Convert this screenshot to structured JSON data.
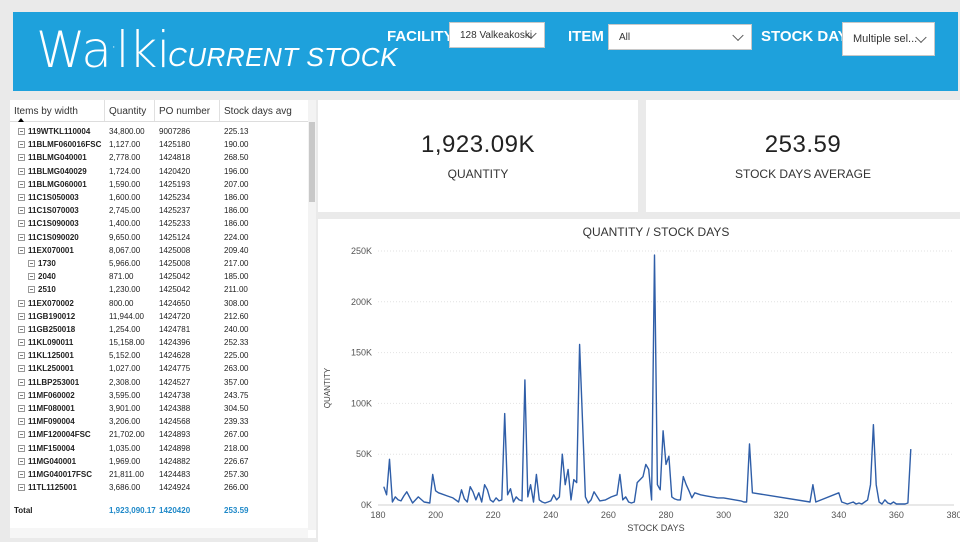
{
  "header": {
    "logo": "walki",
    "title": "CURRENT STOCK",
    "filters": [
      {
        "label": "FACILITY",
        "value": "128 Valkeakoski"
      },
      {
        "label": "ITEM",
        "value": "All"
      },
      {
        "label": "STOCK DAYS",
        "value": "Multiple sel..."
      }
    ]
  },
  "table": {
    "columns": [
      "Items by width",
      "Quantity",
      "PO number",
      "Stock days avg"
    ],
    "rows": [
      {
        "item": "119WTKL110004",
        "qty": "34,800.00",
        "po": "9007286",
        "days": "225.13",
        "level": 0
      },
      {
        "item": "11BLMF060016FSC",
        "qty": "1,127.00",
        "po": "1425180",
        "days": "190.00",
        "level": 0
      },
      {
        "item": "11BLMG040001",
        "qty": "2,778.00",
        "po": "1424818",
        "days": "268.50",
        "level": 0
      },
      {
        "item": "11BLMG040029",
        "qty": "1,724.00",
        "po": "1420420",
        "days": "196.00",
        "level": 0
      },
      {
        "item": "11BLMG060001",
        "qty": "1,590.00",
        "po": "1425193",
        "days": "207.00",
        "level": 0
      },
      {
        "item": "11C1S050003",
        "qty": "1,600.00",
        "po": "1425234",
        "days": "186.00",
        "level": 0
      },
      {
        "item": "11C1S070003",
        "qty": "2,745.00",
        "po": "1425237",
        "days": "186.00",
        "level": 0
      },
      {
        "item": "11C1S090003",
        "qty": "1,400.00",
        "po": "1425233",
        "days": "186.00",
        "level": 0
      },
      {
        "item": "11C1S090020",
        "qty": "9,650.00",
        "po": "1425124",
        "days": "224.00",
        "level": 0
      },
      {
        "item": "11EX070001",
        "qty": "8,067.00",
        "po": "1425008",
        "days": "209.40",
        "level": 0
      },
      {
        "item": "1730",
        "qty": "5,966.00",
        "po": "1425008",
        "days": "217.00",
        "level": 1
      },
      {
        "item": "2040",
        "qty": "871.00",
        "po": "1425042",
        "days": "185.00",
        "level": 1
      },
      {
        "item": "2510",
        "qty": "1,230.00",
        "po": "1425042",
        "days": "211.00",
        "level": 1
      },
      {
        "item": "11EX070002",
        "qty": "800.00",
        "po": "1424650",
        "days": "308.00",
        "level": 0
      },
      {
        "item": "11GB190012",
        "qty": "11,944.00",
        "po": "1424720",
        "days": "212.60",
        "level": 0
      },
      {
        "item": "11GB250018",
        "qty": "1,254.00",
        "po": "1424781",
        "days": "240.00",
        "level": 0
      },
      {
        "item": "11KL090011",
        "qty": "15,158.00",
        "po": "1424396",
        "days": "252.33",
        "level": 0
      },
      {
        "item": "11KL125001",
        "qty": "5,152.00",
        "po": "1424628",
        "days": "225.00",
        "level": 0
      },
      {
        "item": "11KL250001",
        "qty": "1,027.00",
        "po": "1424775",
        "days": "263.00",
        "level": 0
      },
      {
        "item": "11LBP253001",
        "qty": "2,308.00",
        "po": "1424527",
        "days": "357.00",
        "level": 0
      },
      {
        "item": "11MF060002",
        "qty": "3,595.00",
        "po": "1424738",
        "days": "243.75",
        "level": 0
      },
      {
        "item": "11MF080001",
        "qty": "3,901.00",
        "po": "1424388",
        "days": "304.50",
        "level": 0
      },
      {
        "item": "11MF090004",
        "qty": "3,206.00",
        "po": "1424568",
        "days": "239.33",
        "level": 0
      },
      {
        "item": "11MF120004FSC",
        "qty": "21,702.00",
        "po": "1424893",
        "days": "267.00",
        "level": 0
      },
      {
        "item": "11MF150004",
        "qty": "1,035.00",
        "po": "1424898",
        "days": "218.00",
        "level": 0
      },
      {
        "item": "11MG040001",
        "qty": "1,969.00",
        "po": "1424882",
        "days": "226.67",
        "level": 0
      },
      {
        "item": "11MG040017FSC",
        "qty": "21,811.00",
        "po": "1424483",
        "days": "257.30",
        "level": 0
      },
      {
        "item": "11TL1125001",
        "qty": "3,686.00",
        "po": "1424924",
        "days": "266.00",
        "level": 0
      }
    ],
    "total": {
      "label": "Total",
      "qty": "1,923,090.17",
      "po": "1420420",
      "days": "253.59"
    }
  },
  "kpis": [
    {
      "value": "1,923.09K",
      "label": "QUANTITY"
    },
    {
      "value": "253.59",
      "label": "STOCK DAYS AVERAGE"
    }
  ],
  "chart_data": {
    "type": "line",
    "title": "QUANTITY / STOCK DAYS",
    "xlabel": "STOCK DAYS",
    "ylabel": "QUANTITY",
    "xlim": [
      180,
      380
    ],
    "ylim": [
      0,
      250000
    ],
    "xticks": [
      180,
      200,
      220,
      240,
      260,
      280,
      300,
      320,
      340,
      360,
      380
    ],
    "yticks": [
      0,
      50000,
      100000,
      150000,
      200000,
      250000
    ],
    "ytick_labels": [
      "0K",
      "50K",
      "100K",
      "150K",
      "200K",
      "250K"
    ],
    "color": "#2f5ea8",
    "series": [
      {
        "x": [
          182,
          183,
          184,
          185,
          186,
          187,
          188,
          189,
          190,
          192,
          194,
          196,
          198,
          199,
          200,
          201,
          202,
          204,
          206,
          208,
          209,
          210,
          211,
          212,
          213,
          214,
          215,
          216,
          217,
          218,
          219,
          220,
          221,
          222,
          223,
          224,
          225,
          226,
          227,
          228,
          229,
          230,
          231,
          232,
          233,
          234,
          235,
          236,
          237,
          238,
          239,
          240,
          241,
          242,
          243,
          244,
          245,
          246,
          247,
          248,
          249,
          250,
          252,
          253,
          254,
          255,
          257,
          259,
          261,
          263,
          264,
          265,
          266,
          267,
          268,
          269,
          270,
          272,
          273,
          274,
          275,
          276,
          277,
          278,
          279,
          280,
          281,
          282,
          283,
          284,
          285,
          286,
          287,
          288,
          289,
          290,
          292,
          294,
          296,
          298,
          300,
          302,
          304,
          306,
          307,
          308,
          309,
          310,
          330,
          331,
          332,
          340,
          341,
          342,
          343,
          344,
          345,
          346,
          347,
          348,
          349,
          350,
          351,
          352,
          353,
          354,
          355,
          356,
          357,
          358,
          359,
          360,
          361,
          362,
          363,
          364,
          365
        ],
        "y": [
          18000,
          10000,
          45000,
          3000,
          8000,
          5000,
          4000,
          9000,
          13000,
          2000,
          8000,
          3000,
          2000,
          30000,
          14000,
          12000,
          11000,
          9000,
          7000,
          3000,
          15000,
          6000,
          3000,
          18000,
          13000,
          5000,
          12000,
          3000,
          20000,
          15000,
          5000,
          3000,
          7000,
          4000,
          5000,
          90000,
          10000,
          16000,
          3000,
          8000,
          5000,
          4000,
          123000,
          8000,
          20000,
          3000,
          30000,
          5000,
          3000,
          2000,
          3000,
          4000,
          10000,
          5000,
          8000,
          50000,
          20000,
          35000,
          5000,
          25000,
          22000,
          158000,
          8000,
          2000,
          5000,
          13000,
          4000,
          5000,
          8000,
          10000,
          30000,
          5000,
          8000,
          3000,
          2000,
          3000,
          22000,
          28000,
          40000,
          35000,
          5000,
          246000,
          20000,
          15000,
          73000,
          40000,
          48000,
          8000,
          6000,
          5000,
          5000,
          28000,
          20000,
          14000,
          7000,
          12000,
          10000,
          9000,
          8000,
          7000,
          7000,
          6000,
          5000,
          4000,
          3000,
          3000,
          60000,
          12000,
          3000,
          20000,
          3000,
          12000,
          3000,
          2000,
          1000,
          2000,
          3000,
          1000,
          2000,
          1000,
          3000,
          5000,
          20000,
          79000,
          20000,
          3000,
          1000,
          5000,
          2000,
          1000,
          3000,
          1000,
          1000,
          1000,
          1000,
          2000,
          55000
        ]
      }
    ]
  }
}
